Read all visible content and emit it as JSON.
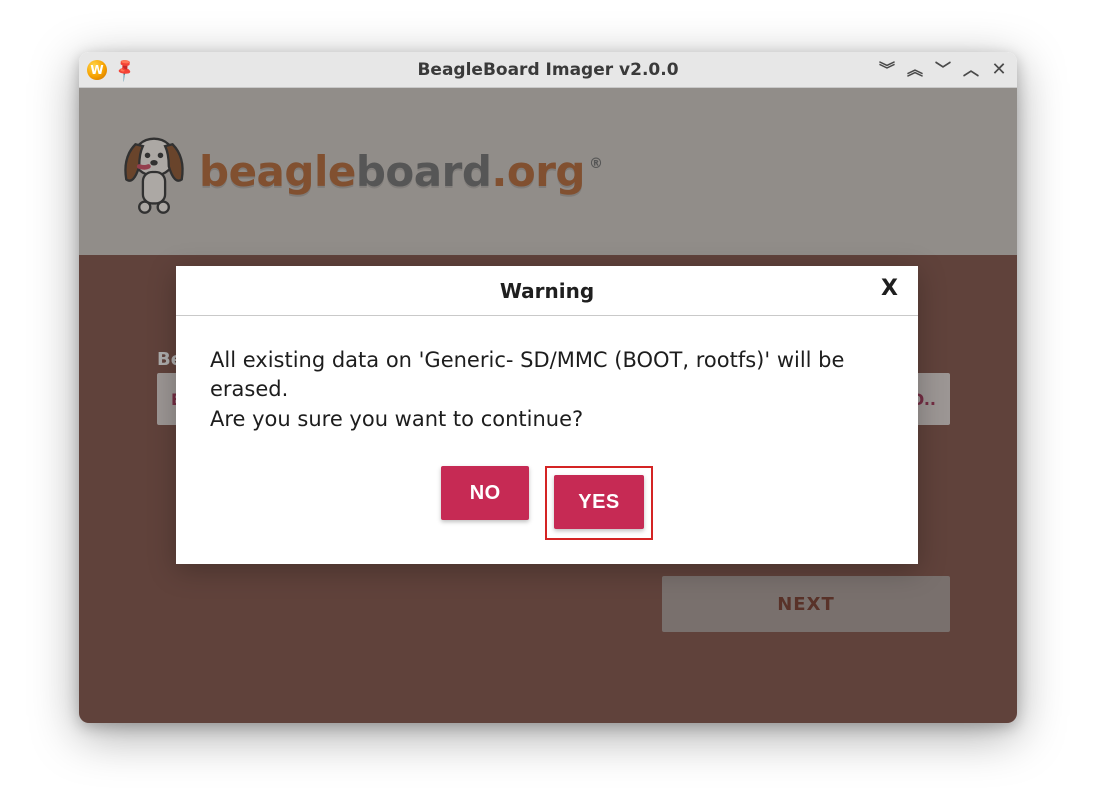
{
  "titlebar": {
    "app_icon_letter": "W",
    "title": "BeagleBoard Imager v2.0.0"
  },
  "brand": {
    "beagle": "beagle",
    "board": "board",
    "dot": ".",
    "org": "org",
    "registered": "®"
  },
  "main": {
    "label_device": "Be",
    "btn_device": "BE",
    "btn_storage": "OO..",
    "next_label": "NEXT"
  },
  "modal": {
    "title": "Warning",
    "close": "X",
    "line1": "All existing data on 'Generic- SD/MMC (BOOT, rootfs)' will be erased.",
    "line2": "Are you sure you want to continue?",
    "no_label": "NO",
    "yes_label": "YES"
  }
}
